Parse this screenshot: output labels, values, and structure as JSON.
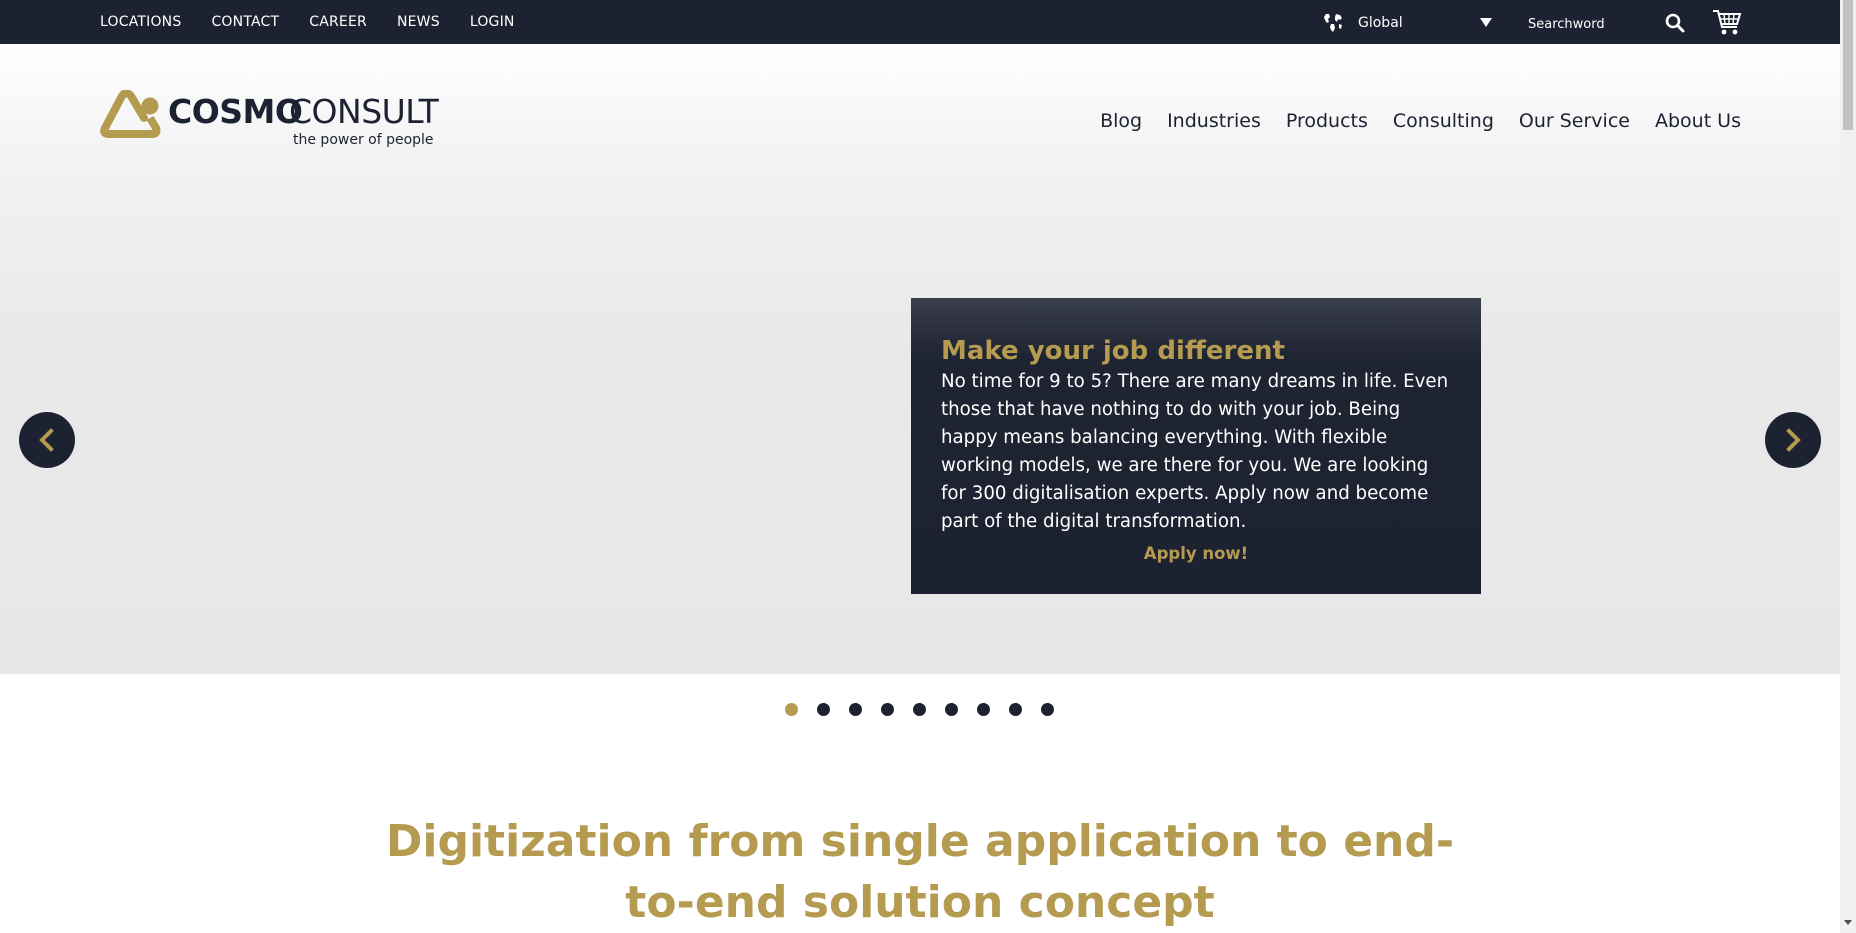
{
  "topbar": {
    "links": [
      "LOCATIONS",
      "CONTACT",
      "CAREER",
      "NEWS",
      "LOGIN"
    ],
    "language": "Global",
    "search_placeholder": "Searchword"
  },
  "header": {
    "logo_cosmo": "COSMO",
    "logo_consult": "CONSULT",
    "logo_tagline": "the power of people",
    "nav": [
      "Blog",
      "Industries",
      "Products",
      "Consulting",
      "Our Service",
      "About Us"
    ]
  },
  "slider": {
    "title": "Make your job different",
    "text": "No time for 9 to 5? There are many dreams in life. Even those that have nothing to do with your job. Being happy means balancing everything. With flexible working models, we are there for you. We are looking for 300 digitalisation experts. Apply now and become part of the digital transformation.",
    "cta": "Apply now!",
    "slide_count": 9,
    "active_slide": 1
  },
  "headline": "Digitization from single application to end-to-end solution concept",
  "colors": {
    "navy": "#1c2231",
    "gold": "#b49b4f"
  },
  "icons": {
    "language": "globe-icon",
    "search": "search-icon",
    "cart": "cart-icon",
    "prev": "chevron-left-icon",
    "next": "chevron-right-icon"
  }
}
